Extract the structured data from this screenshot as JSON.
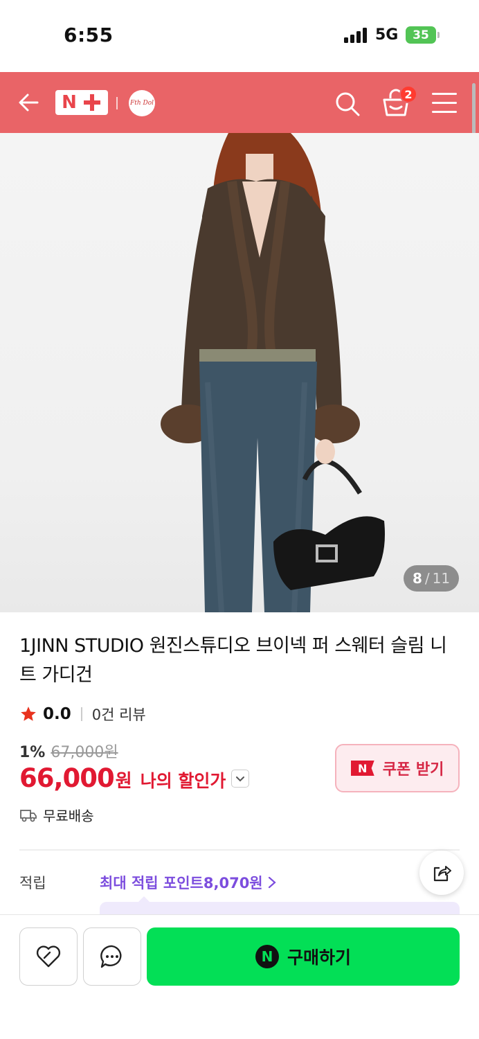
{
  "status_bar": {
    "time": "6:55",
    "network": "5G",
    "battery": "35"
  },
  "header": {
    "logo_text": "N",
    "store_logo_text": "Fth Dol",
    "cart_count": "2"
  },
  "gallery": {
    "current": "8",
    "separator": "/",
    "total": "11"
  },
  "product": {
    "title": "1JINN STUDIO 원진스튜디오 브이넥 퍼 스웨터 슬림 니트 가디건",
    "rating": "0.0",
    "review_count": "0건 리뷰",
    "discount_rate": "1%",
    "original_price": "67,000원",
    "sale_price": "66,000",
    "price_unit": "원",
    "my_price_label": "나의 할인가",
    "coupon_label": "쿠폰 받기",
    "coupon_badge": "N",
    "shipping": "무료배송"
  },
  "points": {
    "label": "적립",
    "text": "최대 적립 포인트 ",
    "value": "8,070원"
  },
  "bottom_bar": {
    "buy_label": "구매하기",
    "buy_badge": "N"
  },
  "colors": {
    "header": "#e96467",
    "price": "#e11932",
    "buy": "#03df56",
    "points": "#7c4dde"
  }
}
